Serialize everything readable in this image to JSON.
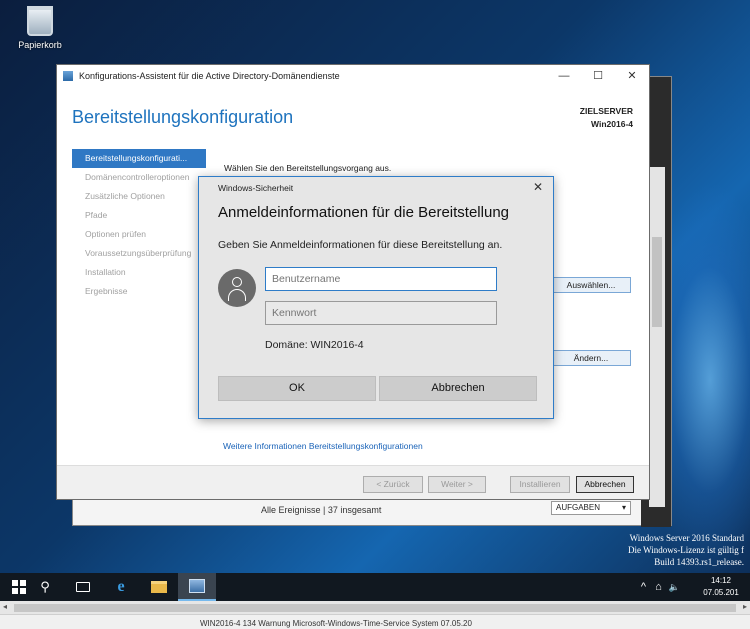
{
  "desktop": {
    "recycle_bin_label": "Papierkorb",
    "server_info": {
      "line1": "Windows Server 2016 Standard",
      "line2": "Die Windows-Lizenz ist gültig f",
      "line3": "Build 14393.rs1_release."
    },
    "background_window": {
      "events_label": "Alle Ereignisse | 37 insgesamt",
      "tasks_button": "AUFGABEN"
    }
  },
  "wizard": {
    "title": "Konfigurations-Assistent für die Active Directory-Domänendienste",
    "heading": "Bereitstellungskonfiguration",
    "target_label": "ZIELSERVER",
    "target_name": "Win2016-4",
    "nav": [
      {
        "label": "Bereitstellungskonfigurati...",
        "active": true
      },
      {
        "label": "Domänencontrolleroptionen",
        "active": false
      },
      {
        "label": "Zusätzliche Optionen",
        "active": false
      },
      {
        "label": "Pfade",
        "active": false
      },
      {
        "label": "Optionen prüfen",
        "active": false
      },
      {
        "label": "Voraussetzungsüberprüfung",
        "active": false
      },
      {
        "label": "Installation",
        "active": false
      },
      {
        "label": "Ergebnisse",
        "active": false
      }
    ],
    "intro": "Wählen Sie den Bereitstellungsvorgang aus.",
    "select_button": "Auswählen...",
    "change_button": "Ändern...",
    "more_info_link": "Weitere Informationen Bereitstellungskonfigurationen",
    "footer": {
      "back": "< Zurück",
      "next": "Weiter >",
      "install": "Installieren",
      "cancel": "Abbrechen"
    }
  },
  "security_dialog": {
    "title": "Windows-Sicherheit",
    "heading": "Anmeldeinformationen für die Bereitstellung",
    "subtitle": "Geben Sie Anmeldeinformationen für diese Bereitstellung an.",
    "username_placeholder": "Benutzername",
    "password_placeholder": "Kennwort",
    "domain_text": "Domäne: WIN2016-4",
    "ok_label": "OK",
    "cancel_label": "Abbrechen"
  },
  "taskbar": {
    "clock_time": "14:12",
    "clock_date": "07.05.201"
  },
  "below_strip": {
    "row_text": "WIN2016-4        134    Warnung    Microsoft-Windows-Time-Service         System        07.05.20"
  },
  "icons": {
    "close": "✕",
    "minimize": "—",
    "maximize": "☐",
    "search": "⚲",
    "tray_up": "^",
    "volume": "🔈"
  }
}
